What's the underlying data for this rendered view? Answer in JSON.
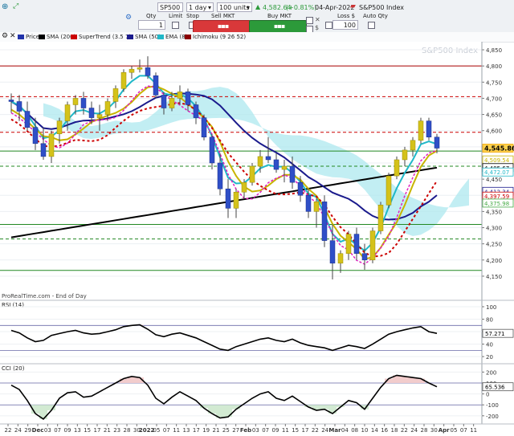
{
  "toolbar": {
    "symbol": "SP500",
    "interval": "1 day",
    "units": "100 units",
    "last_price": "4,582.64",
    "change": "(+0.81%)",
    "date": "04-Apr-2022",
    "instrument_name": "S&P500 Index",
    "qty_label": "Qty",
    "qty_value": "1",
    "limit_label": "Limit",
    "stop_label": "Stop",
    "sell_label": "Sell MKT",
    "buy_label": "Buy MKT",
    "loss_label": "Loss $",
    "loss_value": "100",
    "auto_qty_label": "Auto Qty",
    "accent_up": "#2c9a3a",
    "accent_down": "#d9383a"
  },
  "legend": {
    "items": [
      {
        "label": "Price",
        "color": "#2233aa"
      },
      {
        "label": "SMA (200)",
        "color": "#000000"
      },
      {
        "label": "SuperTrend (3.5 7)",
        "color": "#cc0000"
      },
      {
        "label": "SMA (50)",
        "color": "#1a1a8c"
      },
      {
        "label": "EMA (8)",
        "color": "#20b8c8"
      },
      {
        "label": "Ichimoku (9 26 52)",
        "color": "#8b0000"
      }
    ]
  },
  "chart_data": [
    {
      "type": "candlestick",
      "title": "S&P500 Index",
      "ylim": [
        4130,
        4860
      ],
      "yticks": [
        4150,
        4200,
        4250,
        4300,
        4350,
        4400,
        4450,
        4500,
        4550,
        4600,
        4650,
        4700,
        4750,
        4800,
        4850
      ],
      "ytick_labels": [
        "4,150",
        "4,200",
        "4,250",
        "4,300",
        "4,350",
        "4,400",
        "4,450",
        "4,500",
        "4,550",
        "4,600",
        "4,650",
        "4,700",
        "4,750",
        "4,800",
        "4,850"
      ],
      "xticks": [
        "22",
        "24",
        "29",
        "Dec",
        "03",
        "07",
        "09",
        "13",
        "15",
        "17",
        "21",
        "23",
        "28",
        "30",
        "2022",
        "05",
        "07",
        "11",
        "13",
        "17",
        "19",
        "21",
        "25",
        "27",
        "Feb",
        "03",
        "07",
        "09",
        "11",
        "15",
        "17",
        "22",
        "24",
        "Mar",
        "04",
        "08",
        "10",
        "14",
        "16",
        "18",
        "22",
        "24",
        "28",
        "30",
        "Apr",
        "05",
        "07",
        "11"
      ],
      "price_labels": [
        {
          "text": "4,545.86",
          "value": 4545.86,
          "color": "#f0a500"
        },
        {
          "text": "4,509.54",
          "value": 4509.54,
          "color": "#c8b400"
        },
        {
          "text": "4,485.67",
          "value": 4485.67,
          "color": "#000000"
        },
        {
          "text": "4,472.07",
          "value": 4472.07,
          "color": "#20b8c8"
        },
        {
          "text": "4,412.34",
          "value": 4412.34,
          "color": "#1a1a8c"
        },
        {
          "text": "4,397.59",
          "value": 4397.59,
          "color": "#cc0000"
        },
        {
          "text": "4,375.98",
          "value": 4375.98,
          "color": "#44aa44"
        }
      ],
      "horizontal_levels": [
        {
          "value": 4800,
          "color": "#aa0000",
          "style": "solid"
        },
        {
          "value": 4705,
          "color": "#cc0000",
          "style": "dashed"
        },
        {
          "value": 4595,
          "color": "#cc0000",
          "style": "dashed"
        },
        {
          "value": 4537,
          "color": "#228822",
          "style": "solid"
        },
        {
          "value": 4490,
          "color": "#228822",
          "style": "dashed"
        },
        {
          "value": 4310,
          "color": "#228822",
          "style": "solid"
        },
        {
          "value": 4265,
          "color": "#228822",
          "style": "dashed"
        },
        {
          "value": 4168,
          "color": "#228822",
          "style": "solid"
        }
      ],
      "ohlc": [
        [
          4695,
          4715,
          4655,
          4690
        ],
        [
          4690,
          4710,
          4630,
          4660
        ],
        [
          4660,
          4690,
          4600,
          4610
        ],
        [
          4610,
          4640,
          4540,
          4560
        ],
        [
          4560,
          4610,
          4510,
          4520
        ],
        [
          4520,
          4600,
          4500,
          4590
        ],
        [
          4590,
          4640,
          4560,
          4630
        ],
        [
          4630,
          4690,
          4600,
          4680
        ],
        [
          4680,
          4710,
          4650,
          4700
        ],
        [
          4700,
          4720,
          4650,
          4670
        ],
        [
          4670,
          4690,
          4620,
          4640
        ],
        [
          4640,
          4680,
          4600,
          4650
        ],
        [
          4650,
          4700,
          4630,
          4690
        ],
        [
          4690,
          4740,
          4670,
          4730
        ],
        [
          4730,
          4790,
          4720,
          4780
        ],
        [
          4780,
          4800,
          4760,
          4790
        ],
        [
          4790,
          4820,
          4780,
          4795
        ],
        [
          4795,
          4830,
          4760,
          4770
        ],
        [
          4770,
          4780,
          4700,
          4710
        ],
        [
          4710,
          4720,
          4650,
          4670
        ],
        [
          4670,
          4720,
          4660,
          4700
        ],
        [
          4700,
          4740,
          4680,
          4720
        ],
        [
          4720,
          4730,
          4660,
          4680
        ],
        [
          4680,
          4690,
          4620,
          4640
        ],
        [
          4640,
          4650,
          4570,
          4580
        ],
        [
          4580,
          4590,
          4480,
          4500
        ],
        [
          4500,
          4530,
          4400,
          4420
        ],
        [
          4420,
          4450,
          4330,
          4360
        ],
        [
          4360,
          4420,
          4330,
          4410
        ],
        [
          4410,
          4450,
          4390,
          4440
        ],
        [
          4440,
          4500,
          4430,
          4490
        ],
        [
          4490,
          4540,
          4470,
          4520
        ],
        [
          4520,
          4580,
          4500,
          4510
        ],
        [
          4510,
          4530,
          4470,
          4480
        ],
        [
          4480,
          4510,
          4440,
          4490
        ],
        [
          4490,
          4520,
          4420,
          4440
        ],
        [
          4440,
          4460,
          4380,
          4400
        ],
        [
          4400,
          4420,
          4330,
          4350
        ],
        [
          4350,
          4390,
          4300,
          4380
        ],
        [
          4380,
          4400,
          4240,
          4260
        ],
        [
          4260,
          4310,
          4140,
          4190
        ],
        [
          4190,
          4230,
          4160,
          4220
        ],
        [
          4220,
          4290,
          4200,
          4280
        ],
        [
          4280,
          4300,
          4200,
          4220
        ],
        [
          4220,
          4250,
          4170,
          4200
        ],
        [
          4200,
          4300,
          4190,
          4290
        ],
        [
          4290,
          4380,
          4280,
          4370
        ],
        [
          4370,
          4470,
          4360,
          4460
        ],
        [
          4460,
          4520,
          4450,
          4510
        ],
        [
          4510,
          4550,
          4490,
          4540
        ],
        [
          4540,
          4580,
          4520,
          4570
        ],
        [
          4570,
          4640,
          4560,
          4630
        ],
        [
          4630,
          4640,
          4570,
          4580
        ],
        [
          4580,
          4590,
          4530,
          4545.86
        ]
      ]
    },
    {
      "type": "line",
      "title": "RSI (14)",
      "ylim": [
        15,
        100
      ],
      "yticks": [
        20,
        40,
        60,
        80,
        100
      ],
      "ytick_labels": [
        "20",
        "40",
        "60",
        "80",
        "100"
      ],
      "last_label": "57.271",
      "levels": [
        30,
        70
      ],
      "values": [
        62,
        58,
        50,
        44,
        46,
        54,
        57,
        60,
        62,
        58,
        56,
        57,
        60,
        63,
        68,
        70,
        71,
        64,
        55,
        52,
        56,
        58,
        54,
        50,
        44,
        38,
        32,
        30,
        36,
        40,
        44,
        48,
        50,
        46,
        44,
        48,
        42,
        38,
        36,
        34,
        30,
        34,
        38,
        36,
        33,
        40,
        48,
        56,
        60,
        63,
        66,
        68,
        60,
        57.271
      ]
    },
    {
      "type": "line",
      "title": "CCI (20)",
      "ylim": [
        -260,
        210
      ],
      "yticks": [
        -200,
        -100,
        0,
        100,
        200
      ],
      "ytick_labels": [
        "-200",
        "-100",
        "0",
        "100",
        "200"
      ],
      "last_label": "65.536",
      "levels": [
        -100,
        100
      ],
      "values": [
        80,
        40,
        -60,
        -180,
        -230,
        -150,
        -40,
        10,
        20,
        -30,
        -20,
        20,
        60,
        100,
        140,
        160,
        150,
        80,
        -40,
        -90,
        -30,
        20,
        -20,
        -60,
        -130,
        -180,
        -220,
        -210,
        -140,
        -90,
        -40,
        0,
        20,
        -40,
        -60,
        -20,
        -70,
        -120,
        -150,
        -140,
        -180,
        -120,
        -60,
        -80,
        -140,
        -40,
        60,
        140,
        170,
        160,
        150,
        140,
        100,
        65.536
      ]
    }
  ],
  "footer_text": "ProRealTime.com - End of Day",
  "watermark": "S&P500 Index"
}
